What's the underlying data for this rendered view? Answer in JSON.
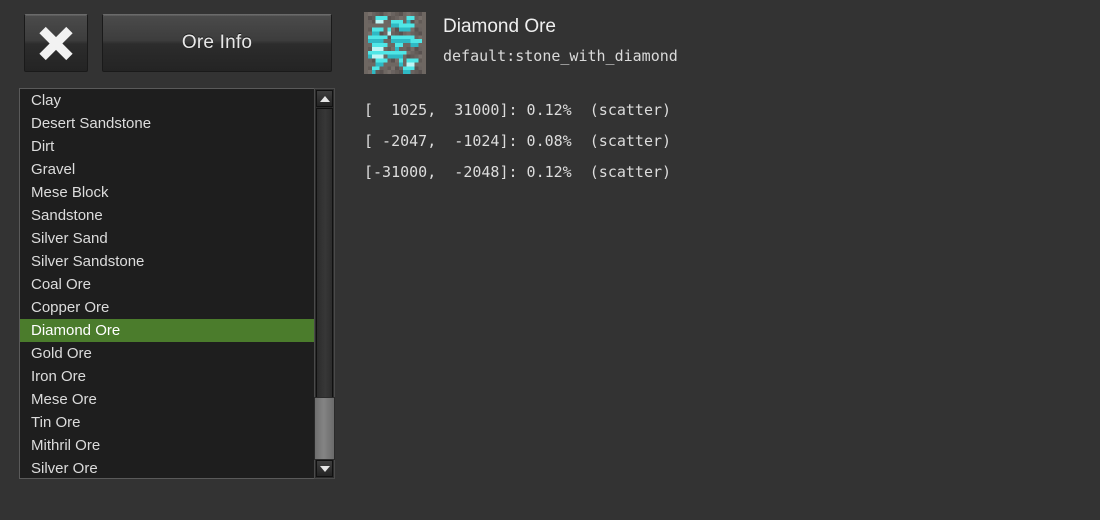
{
  "toolbar": {
    "close_label": "",
    "close_icon": "close-x-icon",
    "ore_info_label": "Ore Info"
  },
  "ore_list": {
    "items": [
      {
        "label": "Clay",
        "selected": false
      },
      {
        "label": "Desert Sandstone",
        "selected": false
      },
      {
        "label": "Dirt",
        "selected": false
      },
      {
        "label": "Gravel",
        "selected": false
      },
      {
        "label": "Mese Block",
        "selected": false
      },
      {
        "label": "Sandstone",
        "selected": false
      },
      {
        "label": "Silver Sand",
        "selected": false
      },
      {
        "label": "Silver Sandstone",
        "selected": false
      },
      {
        "label": "Coal Ore",
        "selected": false
      },
      {
        "label": "Copper Ore",
        "selected": false
      },
      {
        "label": "Diamond Ore",
        "selected": true
      },
      {
        "label": "Gold Ore",
        "selected": false
      },
      {
        "label": "Iron Ore",
        "selected": false
      },
      {
        "label": "Mese Ore",
        "selected": false
      },
      {
        "label": "Tin Ore",
        "selected": false
      },
      {
        "label": "Mithril Ore",
        "selected": false
      },
      {
        "label": "Silver Ore",
        "selected": false
      }
    ],
    "selected_label": "Diamond Ore",
    "scrollbar": {
      "up_arrow_icon": "chevron-up-icon",
      "down_arrow_icon": "chevron-down-icon"
    }
  },
  "detail": {
    "texture_icon": "diamond-ore-texture",
    "title": "Diamond Ore",
    "tech_name": "default:stone_with_diamond",
    "rules": [
      "[  1025,  31000]: 0.12%  (scatter)",
      "[ -2047,  -1024]: 0.08%  (scatter)",
      "[-31000,  -2048]: 0.12%  (scatter)"
    ],
    "rules_parsed": [
      {
        "y_min": 1025,
        "y_max": 31000,
        "chance": "0.12%",
        "type": "scatter"
      },
      {
        "y_min": -2047,
        "y_max": -1024,
        "chance": "0.08%",
        "type": "scatter"
      },
      {
        "y_min": -31000,
        "y_max": -2048,
        "chance": "0.12%",
        "type": "scatter"
      }
    ]
  },
  "colors": {
    "background": "#333333",
    "list_background": "#1e1e1e",
    "selection": "#4b7c2c",
    "text": "#dcdcdc",
    "ore_gem": "#4fe6e6",
    "ore_stone": "#6b6460"
  }
}
